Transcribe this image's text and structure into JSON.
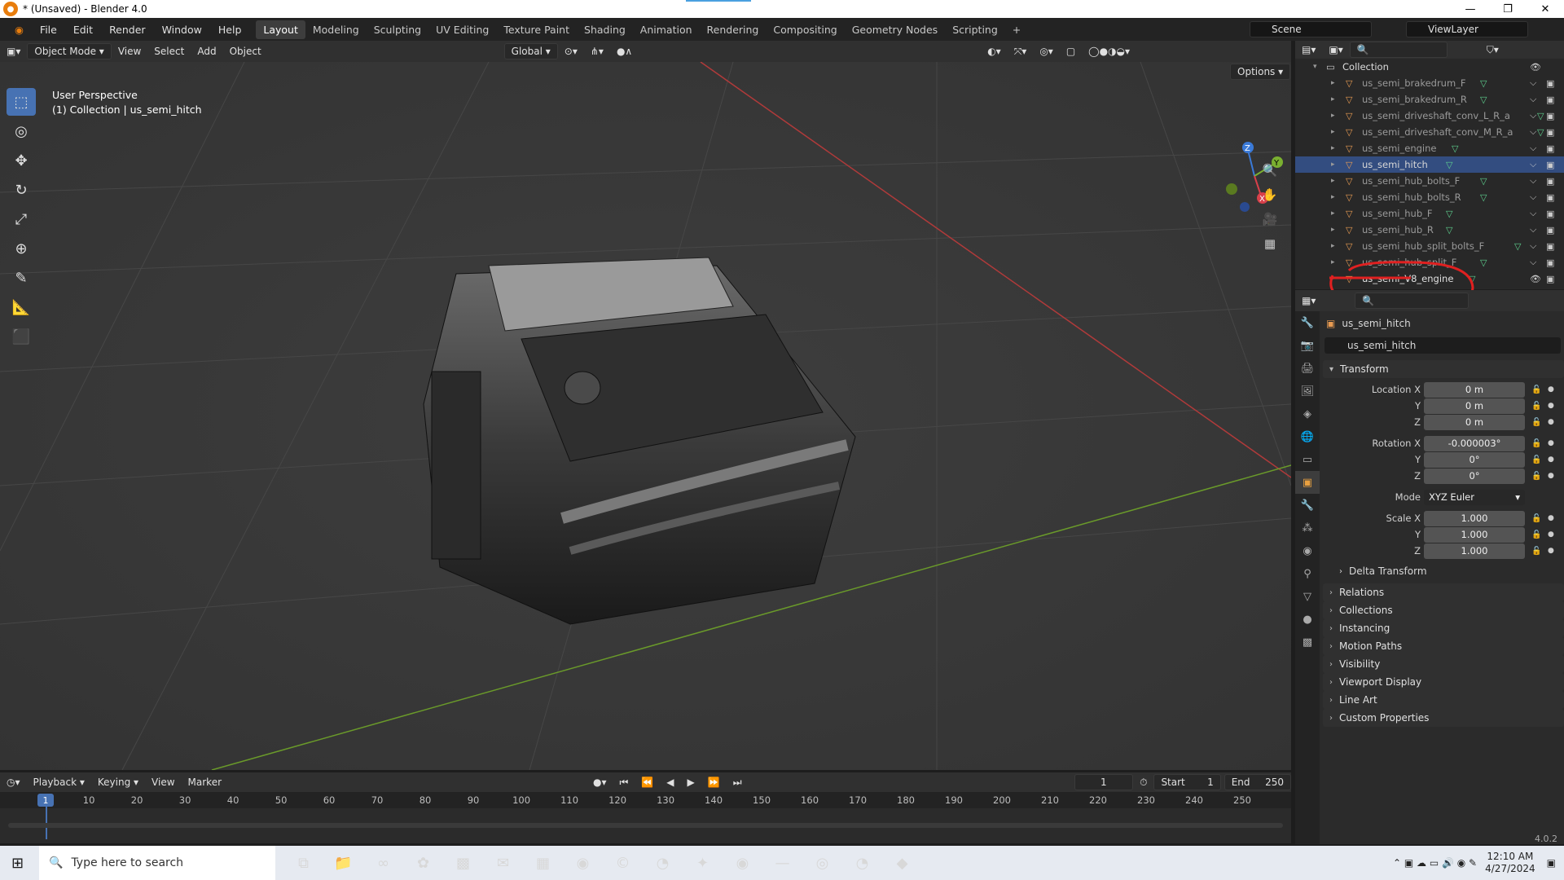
{
  "window": {
    "title": "* (Unsaved) - Blender 4.0"
  },
  "menu": [
    "File",
    "Edit",
    "Render",
    "Window",
    "Help"
  ],
  "workspaces": [
    "Layout",
    "Modeling",
    "Sculpting",
    "UV Editing",
    "Texture Paint",
    "Shading",
    "Animation",
    "Rendering",
    "Compositing",
    "Geometry Nodes",
    "Scripting"
  ],
  "scene": "Scene",
  "view_layer": "ViewLayer",
  "viewport_header": {
    "mode": "Object Mode",
    "menus": [
      "View",
      "Select",
      "Add",
      "Object"
    ],
    "orientation": "Global",
    "options_label": "Options"
  },
  "viewport_info": {
    "line1": "User Perspective",
    "line2": "(1) Collection | us_semi_hitch"
  },
  "outliner": {
    "collection": "Collection",
    "items": [
      {
        "name": "us_semi_brakedrum_F",
        "selected": false
      },
      {
        "name": "us_semi_brakedrum_R",
        "selected": false
      },
      {
        "name": "us_semi_driveshaft_conv_L_R_a",
        "selected": false
      },
      {
        "name": "us_semi_driveshaft_conv_M_R_a",
        "selected": false
      },
      {
        "name": "us_semi_engine",
        "selected": false
      },
      {
        "name": "us_semi_hitch",
        "selected": true
      },
      {
        "name": "us_semi_hub_bolts_F",
        "selected": false
      },
      {
        "name": "us_semi_hub_bolts_R",
        "selected": false
      },
      {
        "name": "us_semi_hub_F",
        "selected": false
      },
      {
        "name": "us_semi_hub_R",
        "selected": false
      },
      {
        "name": "us_semi_hub_split_bolts_F",
        "selected": false
      },
      {
        "name": "us_semi_hub_split_F",
        "selected": false
      },
      {
        "name": "us_semi_V8_engine",
        "selected": false
      }
    ]
  },
  "properties": {
    "object_name": "us_semi_hitch",
    "data_name": "us_semi_hitch",
    "transform_label": "Transform",
    "location": {
      "label": "Location X",
      "x": "0 m",
      "y": "0 m",
      "z": "0 m"
    },
    "rotation": {
      "label": "Rotation X",
      "x": "-0.000003°",
      "y": "0°",
      "z": "0°"
    },
    "mode": {
      "label": "Mode",
      "value": "XYZ Euler"
    },
    "scale": {
      "label": "Scale X",
      "x": "1.000",
      "y": "1.000",
      "z": "1.000"
    },
    "axis_y": "Y",
    "axis_z": "Z",
    "delta_transform": "Delta Transform",
    "panels": [
      "Relations",
      "Collections",
      "Instancing",
      "Motion Paths",
      "Visibility",
      "Viewport Display",
      "Line Art",
      "Custom Properties"
    ]
  },
  "timeline": {
    "menus": [
      "Playback",
      "Keying",
      "View",
      "Marker"
    ],
    "current_frame": "1",
    "start_label": "Start",
    "start": "1",
    "end_label": "End",
    "end": "250",
    "ticks": [
      "1",
      "10",
      "20",
      "30",
      "40",
      "50",
      "60",
      "70",
      "80",
      "90",
      "100",
      "110",
      "120",
      "130",
      "140",
      "150",
      "160",
      "170",
      "180",
      "190",
      "200",
      "210",
      "220",
      "230",
      "240",
      "250"
    ]
  },
  "version": "4.0.2",
  "taskbar": {
    "search_placeholder": "Type here to search",
    "time": "12:10 AM",
    "date": "4/27/2024"
  }
}
